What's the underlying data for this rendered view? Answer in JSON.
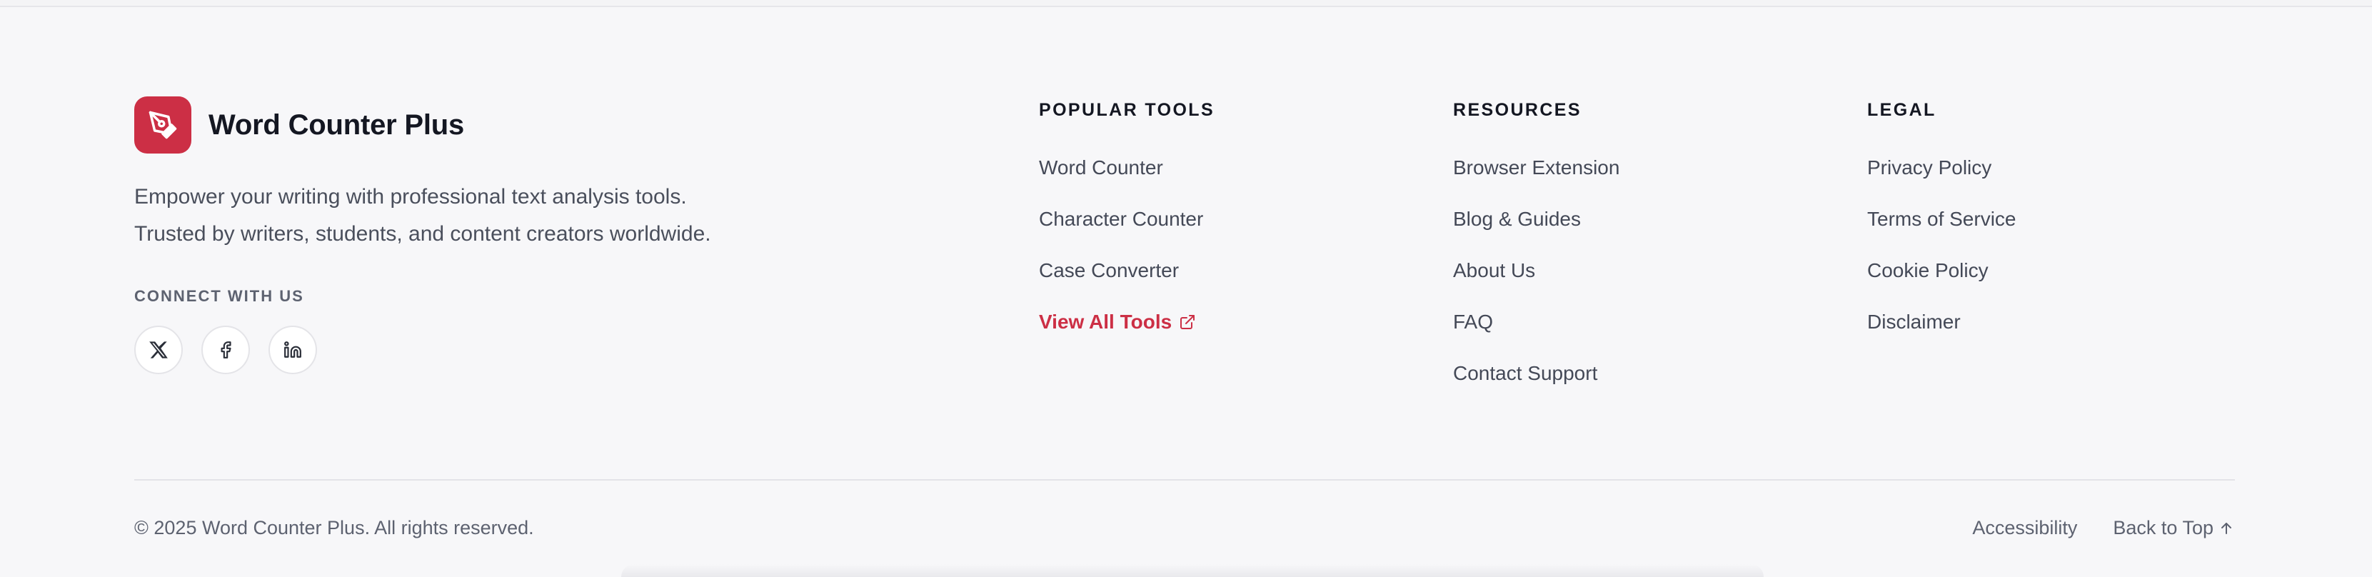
{
  "brand": {
    "name": "Word Counter Plus",
    "logo_icon": "pen-nib-icon",
    "accent_color": "#cc2f45"
  },
  "tagline": {
    "line1": "Empower your writing with professional text analysis tools.",
    "line2": "Trusted by writers, students, and content creators worldwide."
  },
  "connect": {
    "title": "CONNECT WITH US",
    "icons": [
      "x-icon",
      "facebook-icon",
      "linkedin-icon"
    ]
  },
  "columns": {
    "tools": {
      "title": "POPULAR TOOLS",
      "items": [
        "Word Counter",
        "Character Counter",
        "Case Converter",
        "View All Tools"
      ]
    },
    "resources": {
      "title": "RESOURCES",
      "items": [
        "Browser Extension",
        "Blog & Guides",
        "About Us",
        "FAQ",
        "Contact Support"
      ]
    },
    "legal": {
      "title": "LEGAL",
      "items": [
        "Privacy Policy",
        "Terms of Service",
        "Cookie Policy",
        "Disclaimer"
      ]
    }
  },
  "footer": {
    "copyright": "© 2025 Word Counter Plus. All rights reserved.",
    "accessibility": "Accessibility",
    "back_to_top": "Back to Top"
  }
}
